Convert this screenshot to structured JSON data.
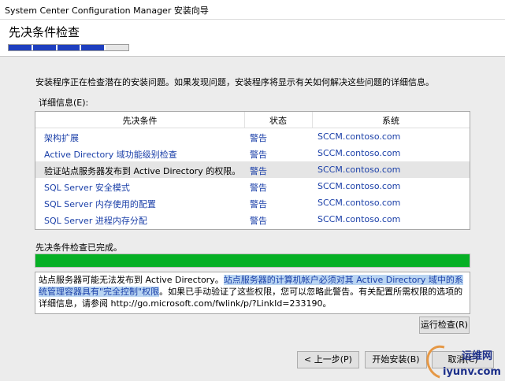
{
  "window": {
    "title": "System Center Configuration Manager 安装向导"
  },
  "header": {
    "page_title": "先决条件检查",
    "step_progress": {
      "completed_steps": 4,
      "total_steps": 5
    }
  },
  "intro_text": "安装程序正在检查潜在的安装问题。如果发现问题，安装程序将显示有关如何解决这些问题的详细信息。",
  "details_label": "详细信息(E):",
  "table": {
    "columns": [
      "先决条件",
      "状态",
      "系统"
    ],
    "rows": [
      {
        "name": "架构扩展",
        "status": "警告",
        "system": "SCCM.contoso.com"
      },
      {
        "name": "Active Directory 域功能级别检查",
        "status": "警告",
        "system": "SCCM.contoso.com"
      },
      {
        "name": "验证站点服务器发布到 Active Directory 的权限。",
        "status": "警告",
        "system": "SCCM.contoso.com",
        "selected": true
      },
      {
        "name": "SQL Server 安全模式",
        "status": "警告",
        "system": "SCCM.contoso.com"
      },
      {
        "name": "SQL Server 内存使用的配置",
        "status": "警告",
        "system": "SCCM.contoso.com"
      },
      {
        "name": "SQL Server 进程内存分配",
        "status": "警告",
        "system": "SCCM.contoso.com"
      }
    ]
  },
  "completed_text": "先决条件检查已完成。",
  "progress": {
    "percent": 100,
    "color": "#06b025"
  },
  "description": {
    "part1": "站点服务器可能无法发布到 Active Directory。",
    "part2_highlighted": "站点服务器的计算机帐户必须对其 Active Directory 域中的系统管理容器具有\"完全控制\"权限",
    "part3": "。如果已手动验证了这些权限，您可以忽略此警告。有关配置所需权限的选项的详细信息，请参阅 http://go.microsoft.com/fwlink/p/?LinkId=233190。"
  },
  "buttons": {
    "run_check": "运行检查(R)",
    "back": "< 上一步(P)",
    "install": "开始安装(B)",
    "cancel": "取消(C)"
  },
  "watermark": {
    "name": "运维网",
    "url": "iyunv.com"
  },
  "colors": {
    "accent_blue": "#1e3fbf",
    "link_blue": "#1a3fa8",
    "highlight": "#b8d4f2"
  }
}
